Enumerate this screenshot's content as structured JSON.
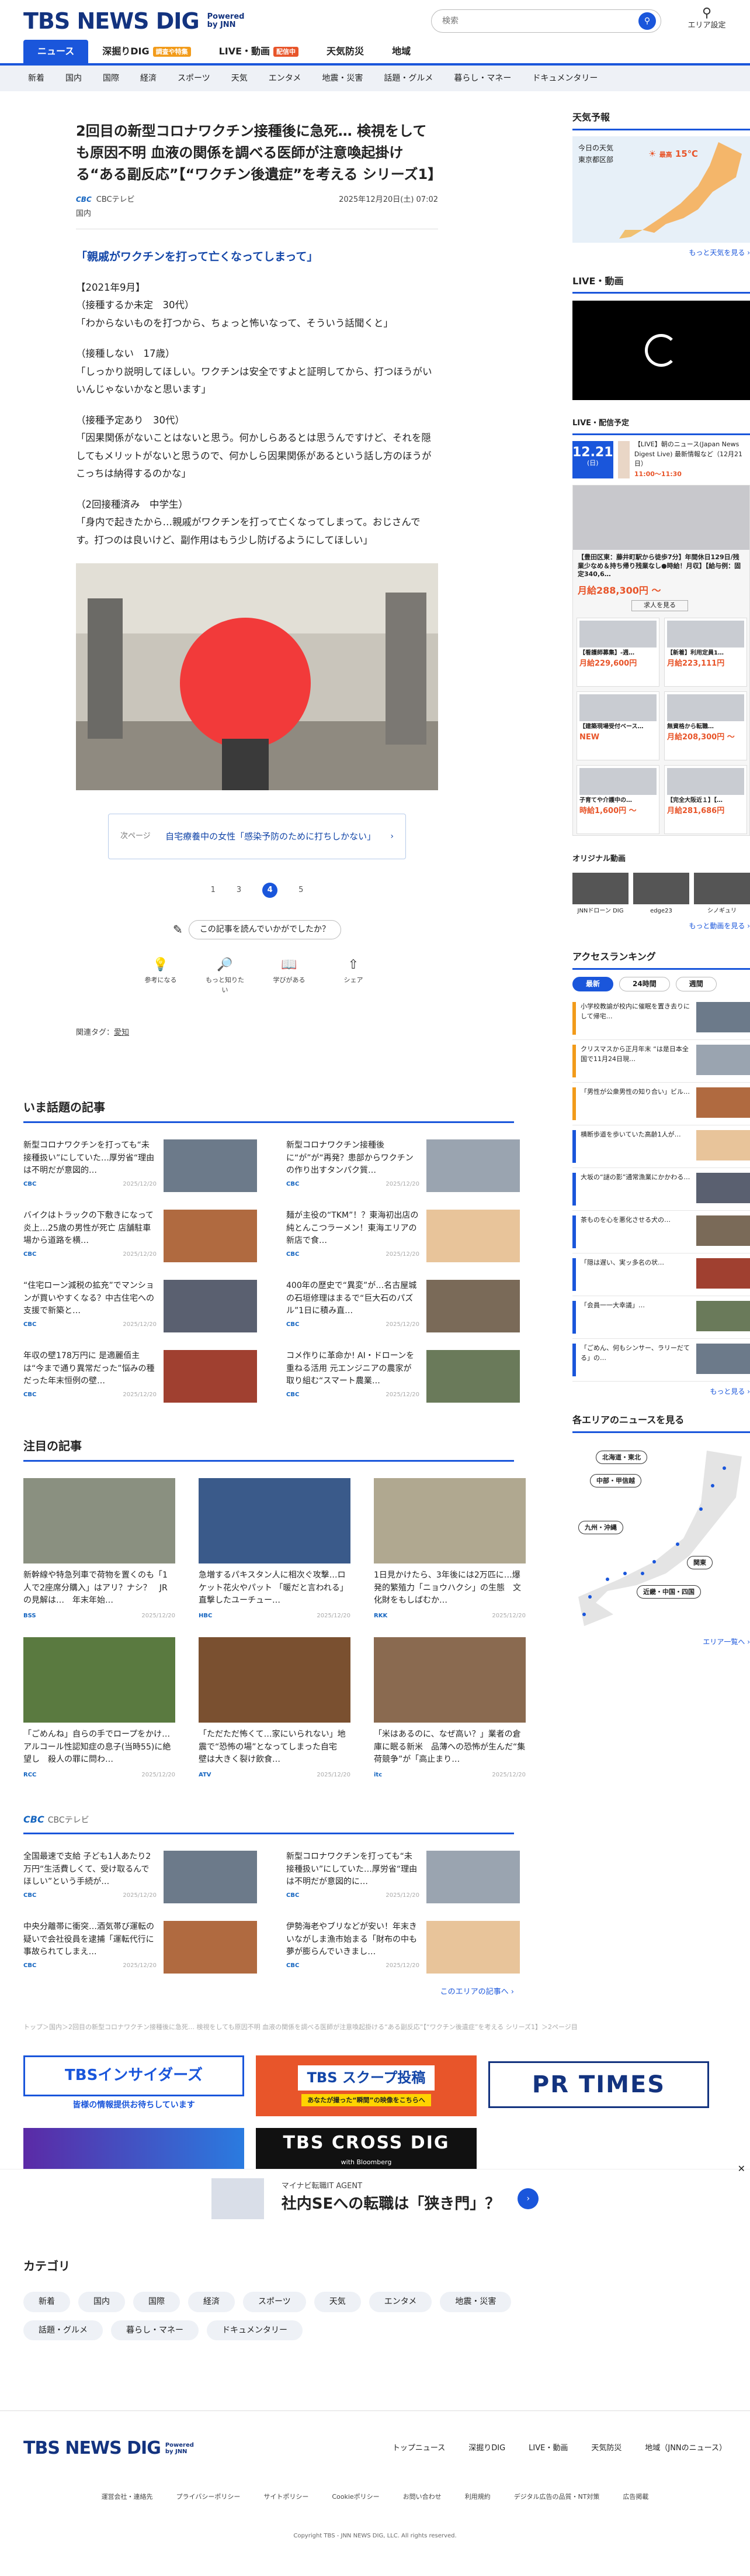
{
  "header": {
    "logo": "TBS NEWS DIG",
    "logo_sub1": "Powered",
    "logo_sub2": "by JNN",
    "search_placeholder": "検索",
    "area_label": "エリア設定"
  },
  "nav": [
    {
      "label": "ニュース",
      "active": true
    },
    {
      "label": "深掘りDIG",
      "badge": "調査や特集"
    },
    {
      "label": "LIVE・動画",
      "badge": "配信中"
    },
    {
      "label": "天気防災"
    },
    {
      "label": "地域"
    }
  ],
  "subnav": [
    "新着",
    "国内",
    "国際",
    "経済",
    "スポーツ",
    "天気",
    "エンタメ",
    "地震・災害",
    "話題・グルメ",
    "暮らし・マネー",
    "ドキュメンタリー"
  ],
  "article": {
    "title": "2回目の新型コロナワクチン接種後に急死… 検視をしても原因不明 血液の関係を調べる医師が注意喚起掛ける“ある副反応”【“ワクチン後遺症”を考える シリーズ1】",
    "source": "CBCテレビ",
    "date": "2025年12月20日(土) 07:02",
    "category": "国内",
    "lead": "「親戚がワクチンを打って亡くなってしまって」",
    "paras": [
      [
        "【2021年9月】",
        "（接種するか未定　30代）",
        "「わからないものを打つから、ちょっと怖いなって、そういう話聞くと」"
      ],
      [
        "（接種しない　17歳）",
        "「しっかり説明してほしい。ワクチンは安全ですよと証明してから、打つほうがいいんじゃないかなと思います」"
      ],
      [
        "（接種予定あり　30代）",
        "「因果関係がないことはないと思う。何かしらあるとは思うんですけど、それを隠してもメリットがないと思うので、何かしら因果関係があるという話し方のほうがこっちは納得するのかな」"
      ],
      [
        "（2回接種済み　中学生）",
        "「身内で起きたから…親戚がワクチンを打って亡くなってしまって。おじさんです。打つのは良いけど、副作用はもう少し防げるようにしてほしい」"
      ]
    ],
    "next_label": "次ページ",
    "next_text": "自宅療養中の女性「感染予防のために打ちしかない」",
    "pages": [
      "1",
      "3",
      "4",
      "5"
    ],
    "current_page": "4",
    "feedback_q": "この記事を読んでいかがでしたか？",
    "reactions": [
      "参考になる",
      "もっと知りたい",
      "学びがある",
      "シェア"
    ],
    "tags": "関連タグ：",
    "tag": "愛知"
  },
  "trending": {
    "title": "いま話題の記事",
    "items": [
      {
        "t": "新型コロナワクチンを打っても“未接種扱い”にしていた…厚労省“理由は不明だが意図的…",
        "s": "CBC",
        "d": "2025/12/20"
      },
      {
        "t": "新型コロナワクチン接種後に“が”が“再発？患部からワクチンの作り出すタンパク質…",
        "s": "CBC",
        "d": "2025/12/20"
      },
      {
        "t": "バイクはトラックの下敷きになって炎上…25歳の男性が死亡 店舗駐車場から道路を横…",
        "s": "CBC",
        "d": "2025/12/20"
      },
      {
        "t": "麺が主役の“TKM”！？東海初出店の純とんこつラーメン！東海エリアの新店で食…",
        "s": "CBC",
        "d": "2025/12/20"
      },
      {
        "t": "“住宅ローン減税の拡充”でマンションが買いやすくなる？中古住宅への支援で新築と…",
        "s": "CBC",
        "d": "2025/12/20"
      },
      {
        "t": "400年の歴史で“異変”が…名古屋城の石垣修理はまるで“巨大石のパズル”1日に積み直…",
        "s": "CBC",
        "d": "2025/12/20"
      },
      {
        "t": "年収の壁178万円に 是適麗佰主は“今まで通り異常だった”悩みの種だった年末恒例の壁…",
        "s": "CBC",
        "d": "2025/12/20"
      },
      {
        "t": "コメ作りに革命か! AI・ドローンを重ねる活用 元エンジニアの農家が取り組む“スマート農業…",
        "s": "CBC",
        "d": "2025/12/20"
      }
    ]
  },
  "featured": {
    "title": "注目の記事",
    "items": [
      {
        "t": "新幹線や特急列車で荷物を置くのも「1人で2座席分購入」はアリ？ナシ？　JRの見解は…　年末年始…",
        "s": "BSS",
        "d": "2025/12/20"
      },
      {
        "t": "急増するパキスタン人に相次ぐ攻撃…ロケット花火やパット 「暖だと言われる」直撃したユーチュー…",
        "s": "HBC",
        "d": "2025/12/20"
      },
      {
        "t": "1日見かけたら、3年後には2万匹に…爆発的繁殖力「ニョウハクシ」の生態　文化財をもしばむか…",
        "s": "RKK",
        "d": "2025/12/20"
      },
      {
        "t": "「ごめんね」自らの手でロープをかけ…アルコール性認知症の息子(当時55)に絶望し　殺人の罪に問わ…",
        "s": "RCC",
        "d": "2025/12/20"
      },
      {
        "t": "「ただただ怖くて…家にいられない」地震で“恐怖の場”となってしまった自宅　壁は大きく裂け飲食…",
        "s": "ATV",
        "d": "2025/12/20"
      },
      {
        "t": "「米はあるのに、なぜ高い？」業者の倉庫に眠る新米　品薄への恐怖が生んだ“集荷競争”が「高止まり…",
        "s": "itc",
        "d": "2025/12/20"
      }
    ]
  },
  "cbc": {
    "title": "CBCテレビ",
    "items": [
      {
        "t": "全国最速で支給 子ども1人あたり2万円“生活費しくて、受け取るんでほしい”という手続が…",
        "s": "CBC",
        "d": "2025/12/20"
      },
      {
        "t": "新型コロナワクチンを打っても“未接種扱い”にしていた…厚労省“理由は不明だが意図的に…",
        "s": "CBC",
        "d": "2025/12/20"
      },
      {
        "t": "中央分離帯に衝突…酒気帯び運転の疑いで会社役員を逮捕「運転代行に事故られてしまえ…",
        "s": "CBC",
        "d": "2025/12/20"
      },
      {
        "t": "伊勢海老やブリなどが安い！年末きいながしま漁市始まる「財布の中も夢が膨らんでいきまし…",
        "s": "CBC",
        "d": "2025/12/20"
      }
    ],
    "more": "このエリアの記事へ ›"
  },
  "right": {
    "weather_title": "天気予報",
    "weather_line1": "今日の天気",
    "weather_line2": "東京都区部",
    "weather_temp_lbl": "最高",
    "weather_temp": "15℃",
    "weather_more": "もっと天気を見る ›",
    "live_title": "LIVE・動画",
    "schedule_title": "LIVE・配信予定",
    "schedule_date": "12.21",
    "schedule_day": "(日)",
    "schedule_text": "【LIVE】朝のニュース(Japan News Digest Live) 最新情報など（12月21日）",
    "schedule_time": "11:00～11:30",
    "ad_title1": "【豊田区東：藤井町駅から徒歩7分】年間休日129日/残業少なめ＆持ち帰り残業なし●時給！月収】【給与例：固定340,6…",
    "ad_price1": "月給288,300円 ～",
    "ad_sub1": "求人を見る",
    "ad_grid": [
      {
        "t": "【看護師募集】-週…",
        "p": "月給229,600円"
      },
      {
        "t": "【新着】利用定員1…",
        "p": "月給223,111円"
      },
      {
        "t": "【建築現場受付ベース…",
        "p": "NEW"
      },
      {
        "t": "無資格から転職…",
        "p": "月給208,300円 ～"
      },
      {
        "t": "子育てや介護中の…",
        "p": "時給1,600円 ～"
      },
      {
        "t": "【完全大阪近１】【…",
        "p": "月給281,686円"
      }
    ],
    "original_title": "オリジナル動画",
    "originals": [
      "JNNドローン DIG",
      "edge23",
      "シノギュリ"
    ],
    "original_more": "もっと動画を見る ›",
    "ranking_title": "アクセスランキング",
    "ranking_tabs": [
      "最新",
      "24時間",
      "週間"
    ],
    "ranking": [
      "小学校教諭が校内に催眠を置き去りにして帰宅…",
      "クリスマスから正月年末 “は是日本全国で11月24日現…",
      "「男性が公衆男性の知り合い」ビル…",
      "横断歩道を歩いていた高齢1人が…",
      "大坂の“謎の影”通常漁業にかかわる…",
      "茶ものを心を悪化させる犬の…",
      "「隠は遅い、実ッ多名の状…",
      "「会員一一大幸議」…",
      "「ごめん、何もシンサー、ラリーだてる」の…"
    ],
    "ranking_more": "もっと見る ›",
    "area_title": "各エリアのニュースを見る",
    "area_buttons": [
      "北海道・東北",
      "中部・甲信越",
      "九州・沖縄",
      "関東",
      "近畿・中国・四国"
    ],
    "area_more": "エリア一覧へ ›"
  },
  "breadcrumb": "トップ＞国内＞2回目の新型コロナワクチン接種後に急死… 検視をしても原因不明 血液の関係を調べる医師が注意喚起掛ける“ある副反応”【“ワクチン後遺症”を考える シリーズ1】＞2ページ目",
  "banners": {
    "insider": "TBSインサイダーズ",
    "insider_sub": "皆様の情報提供お待ちしています",
    "scoop": "TBS スクープ投稿",
    "scoop_sub": "あなたが撮った“瞬間”の映像をこちらへ",
    "prtimes": "PR TIMES",
    "crossdig": "TBS CROSS DIG",
    "crossdig_sub": "with Bloomberg"
  },
  "sticky_ad": {
    "small": "マイナビ転職IT AGENT",
    "text": "社内SEへの転職は「狭き門」？"
  },
  "categories": {
    "title": "カテゴリ",
    "items": [
      "新着",
      "国内",
      "国際",
      "経済",
      "スポーツ",
      "天気",
      "エンタメ",
      "地震・災害",
      "話題・グルメ",
      "暮らし・マネー",
      "ドキュメンタリー"
    ]
  },
  "footer": {
    "links": [
      "トップニュース",
      "深掘りDIG",
      "LIVE・動画",
      "天気防災",
      "地域（JNNのニュース）"
    ],
    "sub": [
      "運営会社・連絡先",
      "プライバシーポリシー",
      "サイトポリシー",
      "Cookieポリシー",
      "お問い合わせ",
      "利用規約",
      "デジタル広告の品質・NT対策",
      "広告掲載"
    ],
    "copy": "Copyright TBS - JNN NEWS DIG, LLC. All rights reserved."
  }
}
